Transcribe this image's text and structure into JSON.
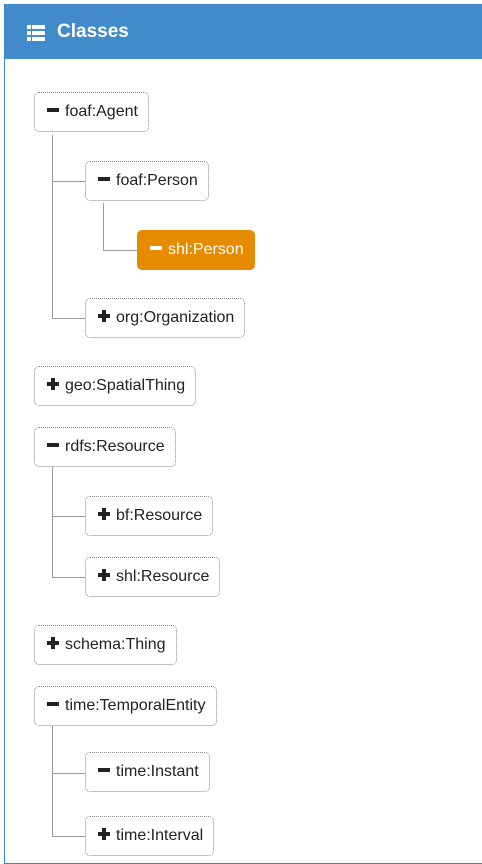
{
  "panel": {
    "title": "Classes",
    "icon": "list-icon"
  },
  "tree": {
    "foaf_agent": {
      "label": "foaf:Agent",
      "state": "expanded"
    },
    "foaf_person": {
      "label": "foaf:Person",
      "state": "expanded"
    },
    "shl_person": {
      "label": "shl:Person",
      "state": "expanded",
      "selected": true
    },
    "org_organization": {
      "label": "org:Organization",
      "state": "collapsed"
    },
    "geo_spatialthing": {
      "label": "geo:SpatialThing",
      "state": "collapsed"
    },
    "rdfs_resource": {
      "label": "rdfs:Resource",
      "state": "expanded"
    },
    "bf_resource": {
      "label": "bf:Resource",
      "state": "collapsed"
    },
    "shl_resource": {
      "label": "shl:Resource",
      "state": "collapsed"
    },
    "schema_thing": {
      "label": "schema:Thing",
      "state": "collapsed"
    },
    "time_temporalentity": {
      "label": "time:TemporalEntity",
      "state": "expanded"
    },
    "time_instant": {
      "label": "time:Instant",
      "state": "expanded"
    },
    "time_interval": {
      "label": "time:Interval",
      "state": "collapsed"
    }
  },
  "colors": {
    "header": "#428bca",
    "selected": "#e68a00"
  }
}
